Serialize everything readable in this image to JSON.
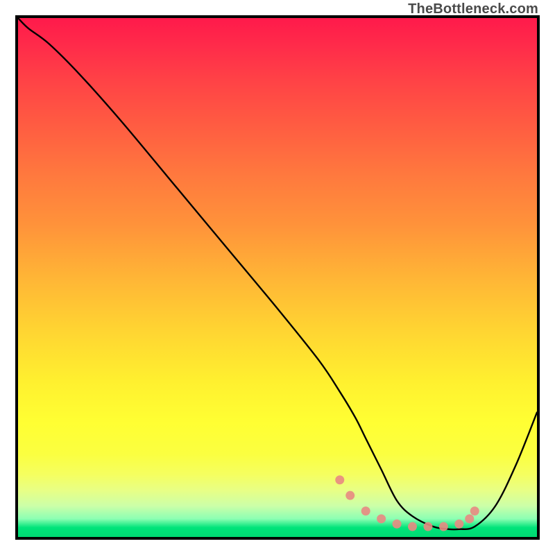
{
  "watermark": "TheBottleneck.com",
  "chart_data": {
    "type": "line",
    "title": "",
    "xlabel": "",
    "ylabel": "",
    "xlim": [
      0,
      100
    ],
    "ylim": [
      0,
      100
    ],
    "grid": false,
    "series": [
      {
        "name": "bottleneck-curve",
        "x": [
          0,
          2,
          6,
          12,
          20,
          30,
          40,
          50,
          58,
          62,
          65,
          67,
          70,
          73,
          76,
          80,
          83,
          85,
          88,
          92,
          96,
          100
        ],
        "values": [
          100,
          98,
          95,
          89,
          80,
          68,
          56,
          44,
          34,
          28,
          23,
          19,
          13,
          7,
          4,
          2,
          1.5,
          1.5,
          2,
          6,
          14,
          24
        ]
      },
      {
        "name": "minimum-markers",
        "type": "scatter",
        "x": [
          62,
          64,
          67,
          70,
          73,
          76,
          79,
          82,
          85,
          87,
          88
        ],
        "values": [
          11,
          8,
          5,
          3.5,
          2.5,
          2,
          2,
          2,
          2.5,
          3.5,
          5
        ]
      }
    ],
    "background_gradient": {
      "top": "#ff1a4b",
      "mid": "#ffff33",
      "bottom": "#00d873"
    }
  }
}
